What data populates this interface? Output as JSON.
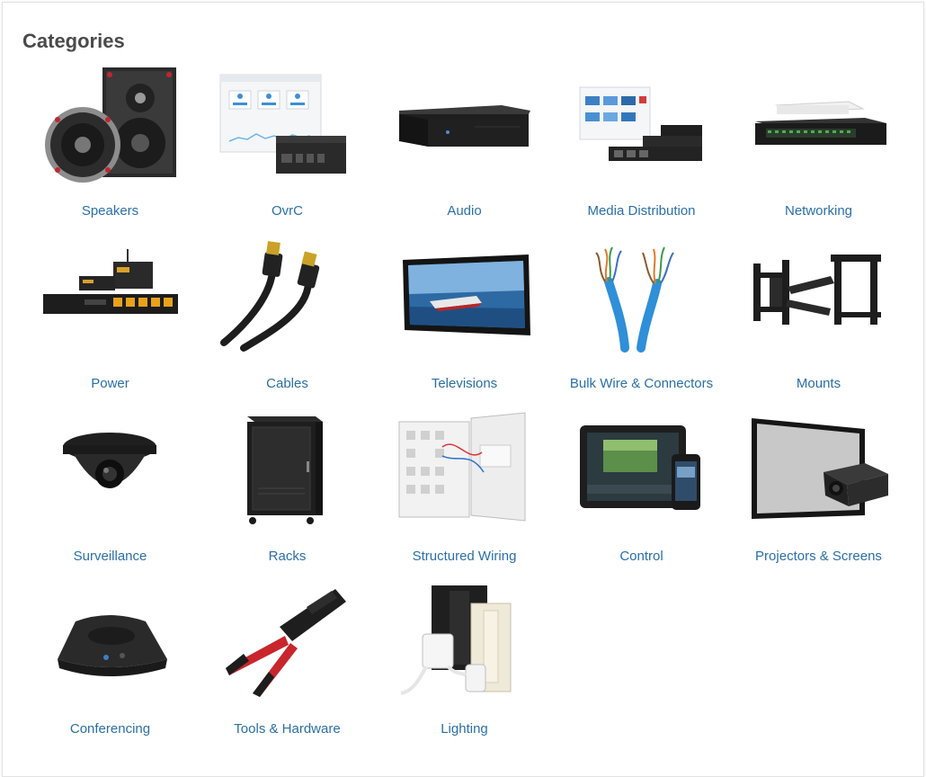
{
  "page": {
    "title": "Categories"
  },
  "categories": [
    {
      "label": "Speakers",
      "icon": "speaker-icon"
    },
    {
      "label": "OvrC",
      "icon": "ovrc-icon"
    },
    {
      "label": "Audio",
      "icon": "audio-amplifier-icon"
    },
    {
      "label": "Media Distribution",
      "icon": "media-distribution-icon"
    },
    {
      "label": "Networking",
      "icon": "network-switch-icon"
    },
    {
      "label": "Power",
      "icon": "power-conditioner-icon"
    },
    {
      "label": "Cables",
      "icon": "hdmi-cable-icon"
    },
    {
      "label": "Televisions",
      "icon": "television-icon"
    },
    {
      "label": "Bulk Wire & Connectors",
      "icon": "bulk-wire-icon"
    },
    {
      "label": "Mounts",
      "icon": "tv-mount-icon"
    },
    {
      "label": "Surveillance",
      "icon": "dome-camera-icon"
    },
    {
      "label": "Racks",
      "icon": "rack-icon"
    },
    {
      "label": "Structured Wiring",
      "icon": "wiring-panel-icon"
    },
    {
      "label": "Control",
      "icon": "tablet-phone-icon"
    },
    {
      "label": "Projectors & Screens",
      "icon": "projector-screen-icon"
    },
    {
      "label": "Conferencing",
      "icon": "conference-phone-icon"
    },
    {
      "label": "Tools & Hardware",
      "icon": "crimp-tool-icon"
    },
    {
      "label": "Lighting",
      "icon": "lighting-icon"
    }
  ],
  "colors": {
    "link": "#2a6fa8",
    "title": "#4a4a4a",
    "border": "#e3e3e3"
  }
}
